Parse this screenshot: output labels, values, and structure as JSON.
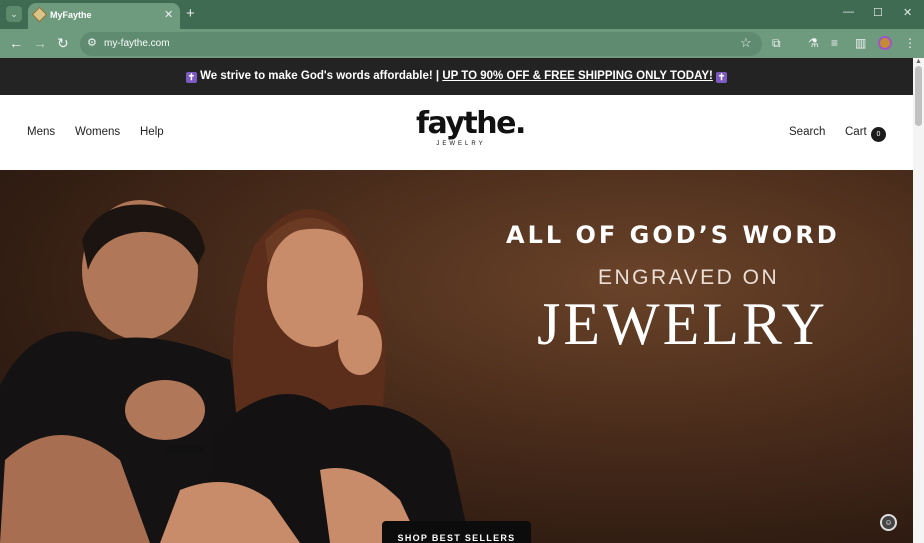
{
  "browser": {
    "tab_title": "MyFaythe",
    "tab_close": "✕",
    "new_tab": "+",
    "url": "my-faythe.com",
    "window_controls": [
      "—",
      "☐",
      "✕"
    ]
  },
  "announcement": {
    "prefix": "We strive to make God's words affordable! |",
    "link": "UP TO 90% OFF & FREE SHIPPING ONLY TODAY!",
    "cross": "✝"
  },
  "header": {
    "nav": [
      "Mens",
      "Womens",
      "Help"
    ],
    "logo_main": "faythe.",
    "logo_sub": "JEWELRY",
    "search": "Search",
    "cart": "Cart",
    "cart_count": "0"
  },
  "hero": {
    "line1": "ALL OF GOD’S WORD",
    "line2": "ENGRAVED ON",
    "line3": "JEWELRY",
    "cta": "SHOP BEST SELLERS"
  },
  "icons": {
    "tab_search": "chevron-down-icon",
    "favicon": "diamond-icon",
    "back": "arrow-left-icon",
    "forward": "arrow-right-icon",
    "reload": "reload-icon",
    "site_info": "tune-icon",
    "bookmark": "star-icon",
    "extensions": "puzzle-icon",
    "labs": "flask-icon",
    "reading_list": "list-icon",
    "side_panel": "side-panel-icon",
    "menu": "more-vertical-icon",
    "chat": "chat-icon"
  },
  "colors": {
    "chrome_dark": "#3f6b52",
    "chrome_light": "#6e9a7e",
    "announcement_bg": "#232323",
    "badge_purple": "#7d5ac1",
    "hero_brown": "#4a2c1b"
  }
}
